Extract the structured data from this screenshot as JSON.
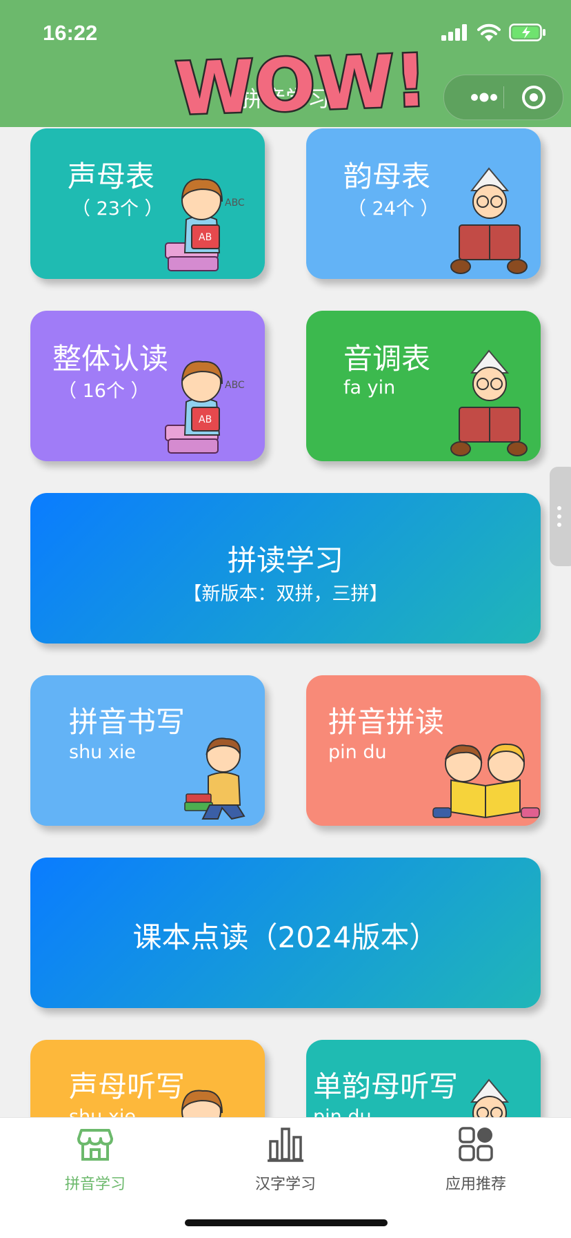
{
  "status": {
    "time": "16:22"
  },
  "nav": {
    "title": "拼音学习"
  },
  "sticker": {
    "text": "WOW!"
  },
  "cards": {
    "shengmu": {
      "title": "声母表",
      "sub": "（ 23个 ）"
    },
    "yunmu": {
      "title": "韵母表",
      "sub": "（ 24个 ）"
    },
    "zhengti": {
      "title": "整体认读",
      "sub": "（ 16个 ）"
    },
    "yindiao": {
      "title": "音调表",
      "sub": "fa yin"
    },
    "pindu_study": {
      "title": "拼读学习",
      "sub": "【新版本：双拼，三拼】"
    },
    "shuxie": {
      "title": "拼音书写",
      "sub": "shu xie"
    },
    "pinyin_pindu": {
      "title": "拼音拼读",
      "sub": "pin du"
    },
    "textbook": {
      "title": "课本点读（2024版本）"
    },
    "shengmu_dictation": {
      "title": "声母听写",
      "sub": "shu xie"
    },
    "danyunmu_dictation": {
      "title": "单韵母听写",
      "sub": "pin du"
    }
  },
  "tabbar": {
    "items": [
      {
        "label": "拼音学习",
        "icon": "store-icon",
        "active": true
      },
      {
        "label": "汉字学习",
        "icon": "bar-chart-icon",
        "active": false
      },
      {
        "label": "应用推荐",
        "icon": "grid-apps-icon",
        "active": false
      }
    ]
  },
  "colors": {
    "header": "#6cb96c",
    "teal": "#1fbbb2",
    "blue": "#63b3f6",
    "purple": "#a07cf7",
    "green": "#3cb94e",
    "salmon": "#f88a78",
    "orange": "#fdb83b",
    "gradient_start": "#0a7cff",
    "gradient_end": "#20b6b8"
  }
}
